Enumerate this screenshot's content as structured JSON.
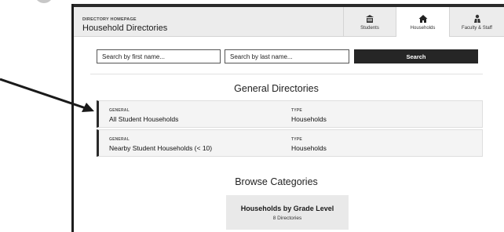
{
  "header": {
    "kicker": "DIRECTORY HOMEPAGE",
    "title": "Household Directories"
  },
  "nav": {
    "tabs": [
      {
        "label": "Students",
        "icon": "school-icon",
        "active": false
      },
      {
        "label": "Households",
        "icon": "house-icon",
        "active": true
      },
      {
        "label": "Faculty & Staff",
        "icon": "staff-icon",
        "active": false
      }
    ]
  },
  "search": {
    "first_placeholder": "Search by first name...",
    "last_placeholder": "Search by last name...",
    "button_label": "Search"
  },
  "general": {
    "title": "General Directories",
    "rows": [
      {
        "group_label": "GENERAL",
        "name": "All Student Households",
        "type_label": "TYPE",
        "type": "Households"
      },
      {
        "group_label": "GENERAL",
        "name": "Nearby Student Households (< 10)",
        "type_label": "TYPE",
        "type": "Households"
      }
    ]
  },
  "browse": {
    "title": "Browse Categories",
    "cards": [
      {
        "title": "Households by Grade Level",
        "count": "8 Directories"
      }
    ]
  },
  "colors": {
    "button_bg": "#262626",
    "header_bg": "#ececec",
    "row_bg": "#f4f4f4",
    "card_bg": "#e9e9e9",
    "arrow": "#1a1a1a"
  }
}
